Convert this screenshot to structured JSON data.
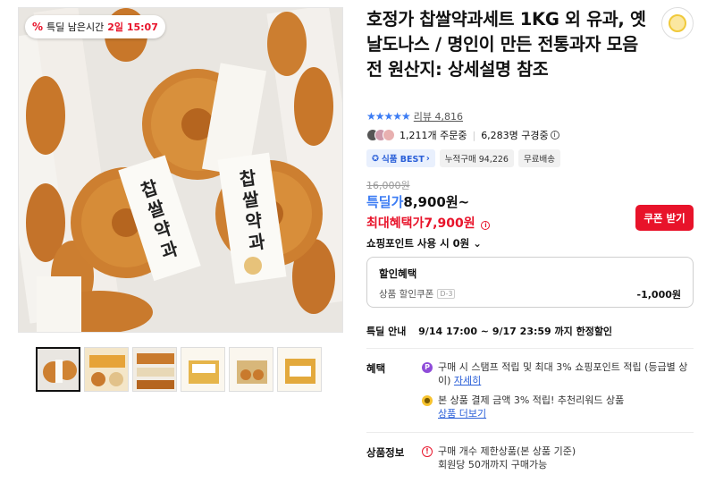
{
  "timer": {
    "icon": "percent-icon",
    "label": "특딜 남은시간",
    "value": "2일 15:07"
  },
  "product": {
    "title": "호정가 찹쌀약과세트 1KG 외 유과, 옛날도나스 / 명인이 만든 전통과자 모음전 원산지: 상세설명 참조",
    "rating_stars": 4.5,
    "review_label": "리뷰 4,816",
    "orders": "1,211개 주문중",
    "viewers": "6,283명 구경중",
    "tags": [
      "식품 BEST",
      "누적구매 94,226",
      "무료배송"
    ]
  },
  "package_labels": [
    "찹쌀약과",
    "찹쌀약과"
  ],
  "price": {
    "original": "16,000원",
    "deal_label": "특딜가",
    "deal_value": "8,900원~",
    "max_label": "최대혜택가",
    "max_value": "7,900원",
    "coupon_button": "쿠폰 받기",
    "points": "쇼핑포인트 사용 시 0원"
  },
  "discount": {
    "title": "할인혜택",
    "item_label": "상품 할인쿠폰",
    "item_badge": "D-3",
    "item_value": "-1,000원"
  },
  "deal_notice": {
    "label": "특딜 안내",
    "value": "9/14 17:00 ~ 9/17 23:59 까지 한정할인"
  },
  "benefits": {
    "label": "혜택",
    "items": [
      {
        "icon": "P",
        "text": "구매 시 스탬프 적립 및 최대 3% 쇼핑포인트 적립 (등급별 상이)",
        "link": "자세히"
      },
      {
        "icon": "coin-icon",
        "text": "본 상품 결제 금액 3% 적립! 추천리워드 상품",
        "link": "상품 더보기"
      }
    ]
  },
  "product_info": {
    "label": "상품정보",
    "line1": "구매 개수 제한상품(본 상품 기준)",
    "line2": "회원당 50개까지 구매가능"
  },
  "colors": {
    "accent_red": "#e8132a",
    "accent_blue": "#3b7cf4"
  }
}
